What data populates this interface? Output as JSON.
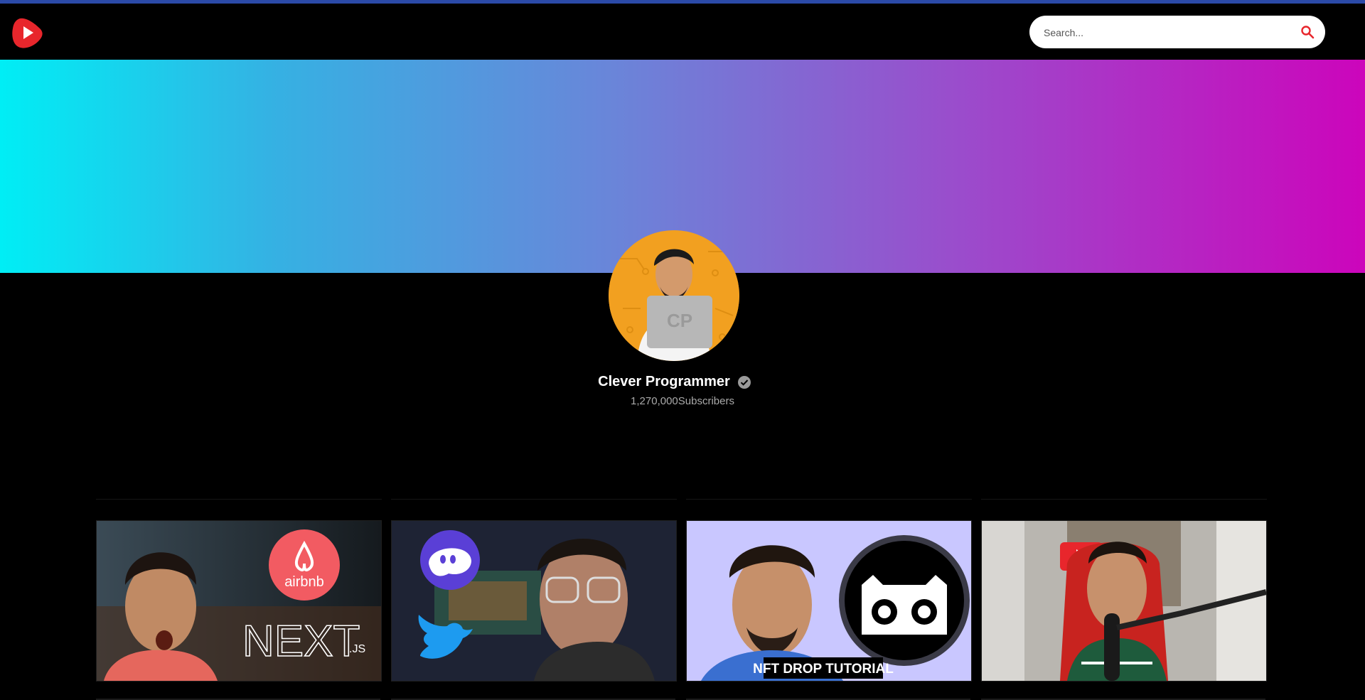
{
  "header": {
    "logo_icon": "youtube-play-logo",
    "search": {
      "placeholder": "Search...",
      "value": "",
      "icon": "search-icon"
    }
  },
  "colors": {
    "banner_start": "#00eef5",
    "banner_end": "#cc05bb",
    "logo_red": "#e8262c",
    "search_icon": "#e8262c",
    "avatar_bg": "#f2a020"
  },
  "channel": {
    "name": "Clever Programmer",
    "verified_icon": "verified-check-icon",
    "subscribers": "1,270,000Subscribers"
  },
  "videos": [
    {
      "thumbnail_text": [
        "airbnb",
        "NEXT",
        ".JS"
      ]
    },
    {
      "thumbnail_text": []
    },
    {
      "thumbnail_text": [
        "NFT DROP TUTORIAL"
      ]
    },
    {
      "thumbnail_text": []
    }
  ]
}
